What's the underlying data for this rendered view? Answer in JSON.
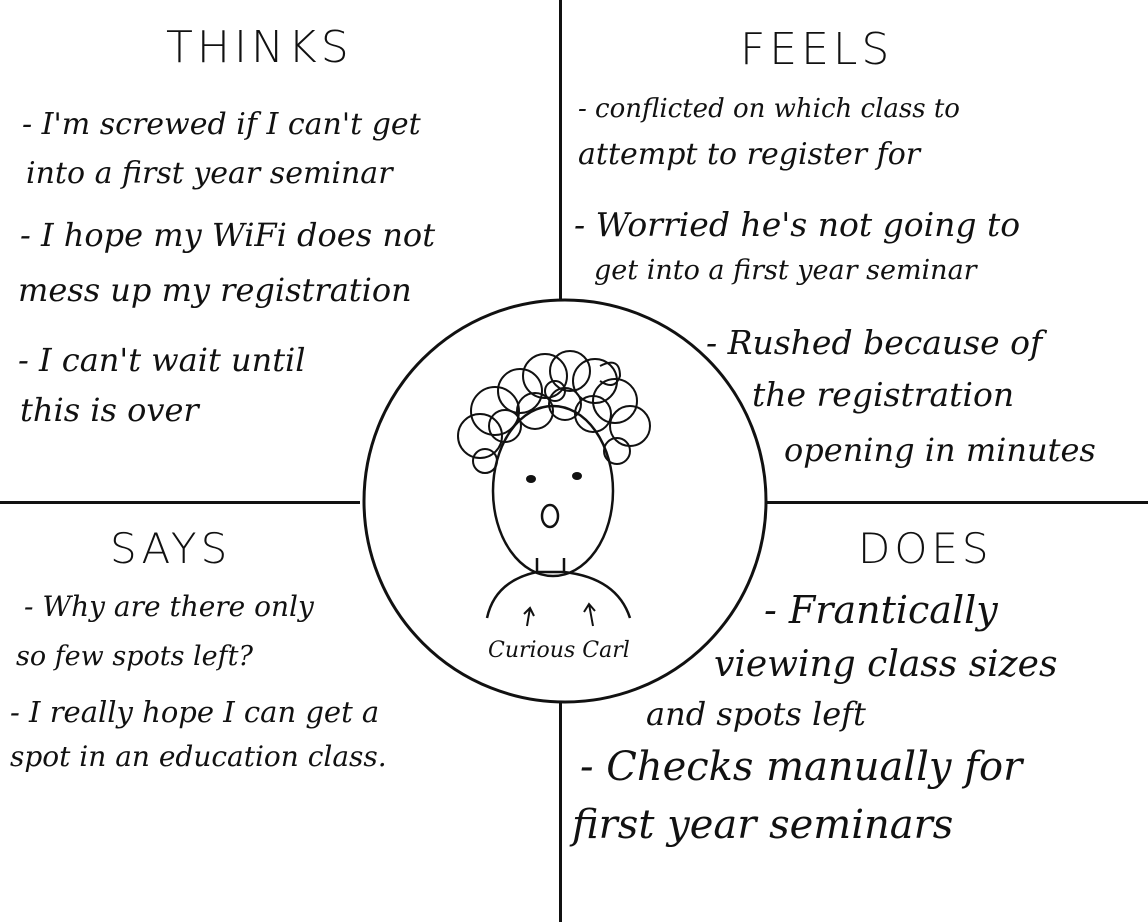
{
  "persona": {
    "name": "Curious Carl"
  },
  "quadrants": {
    "thinks": {
      "title": "THINKS",
      "items": [
        "- I'm screwed if I can't get",
        "into a first year seminar",
        "- I hope my WiFi does not",
        "mess up my registration",
        "- I can't wait until",
        "this is over"
      ]
    },
    "feels": {
      "title": "FEELS",
      "items": [
        "- conflicted on which class to",
        "attempt to register for",
        "- Worried he's not going to",
        "get into a first year seminar",
        "- Rushed because of",
        "the registration",
        "opening in minutes"
      ]
    },
    "says": {
      "title": "SAYS",
      "items": [
        "- Why are there only",
        "so few spots left?",
        "- I really hope I can get a",
        "spot in an education class."
      ]
    },
    "does": {
      "title": "DOES",
      "items": [
        "- Frantically",
        "viewing class sizes",
        "and spots left",
        "- Checks manually for",
        "first year seminars"
      ]
    }
  },
  "colors": {
    "ink": "#111111",
    "background": "#ffffff"
  }
}
